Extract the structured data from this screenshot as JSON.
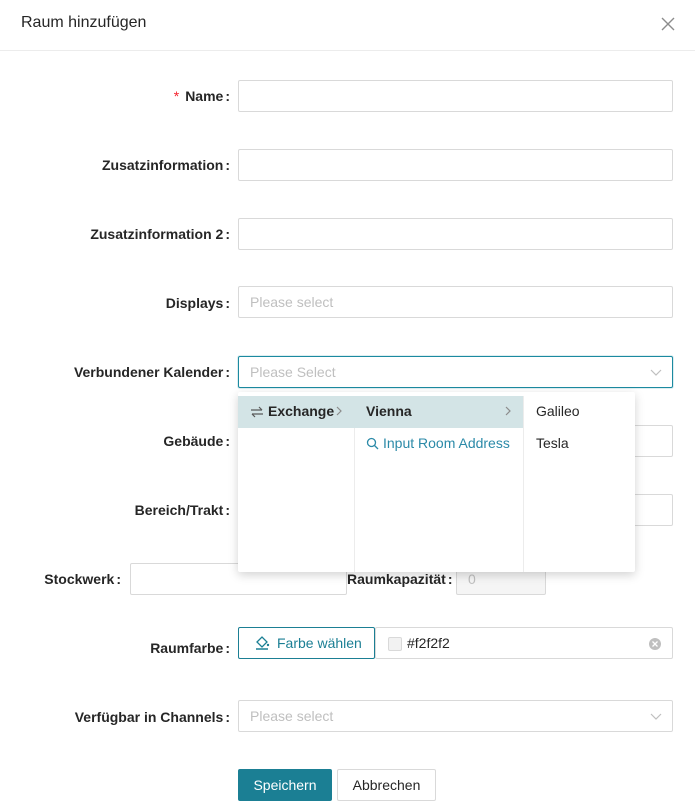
{
  "dialog": {
    "title": "Raum hinzufügen"
  },
  "form": {
    "name_label": "Name",
    "zusatz_label": "Zusatzinformation",
    "zusatz2_label": "Zusatzinformation 2",
    "displays_label": "Displays",
    "displays_placeholder": "Please select",
    "calendar_label": "Verbundener Kalender",
    "calendar_placeholder": "Please Select",
    "gebaeude_label": "Gebäude",
    "bereich_label": "Bereich/Trakt",
    "stockwerk_label": "Stockwerk",
    "kapazitaet_label": "Raumkapazität",
    "kapazitaet_value": "0",
    "farbe_label": "Raumfarbe",
    "farbe_button": "Farbe wählen",
    "farbe_value": "#f2f2f2",
    "channels_label": "Verfügbar in Channels",
    "channels_placeholder": "Please select",
    "colon": ":"
  },
  "cascader": {
    "col1": [
      {
        "label": "Exchange",
        "icon": "swap-icon",
        "active": true
      }
    ],
    "col2": [
      {
        "label": "Vienna",
        "active": true
      },
      {
        "label": "Input Room Address",
        "icon": "search-icon"
      }
    ],
    "col3": [
      {
        "label": "Galileo"
      },
      {
        "label": "Tesla"
      }
    ]
  },
  "footer": {
    "save_label": "Speichern",
    "cancel_label": "Abbrechen"
  },
  "colors": {
    "primary": "#1b7f94",
    "active_option_bg": "#d3e4e6",
    "required": "#f5222d"
  }
}
